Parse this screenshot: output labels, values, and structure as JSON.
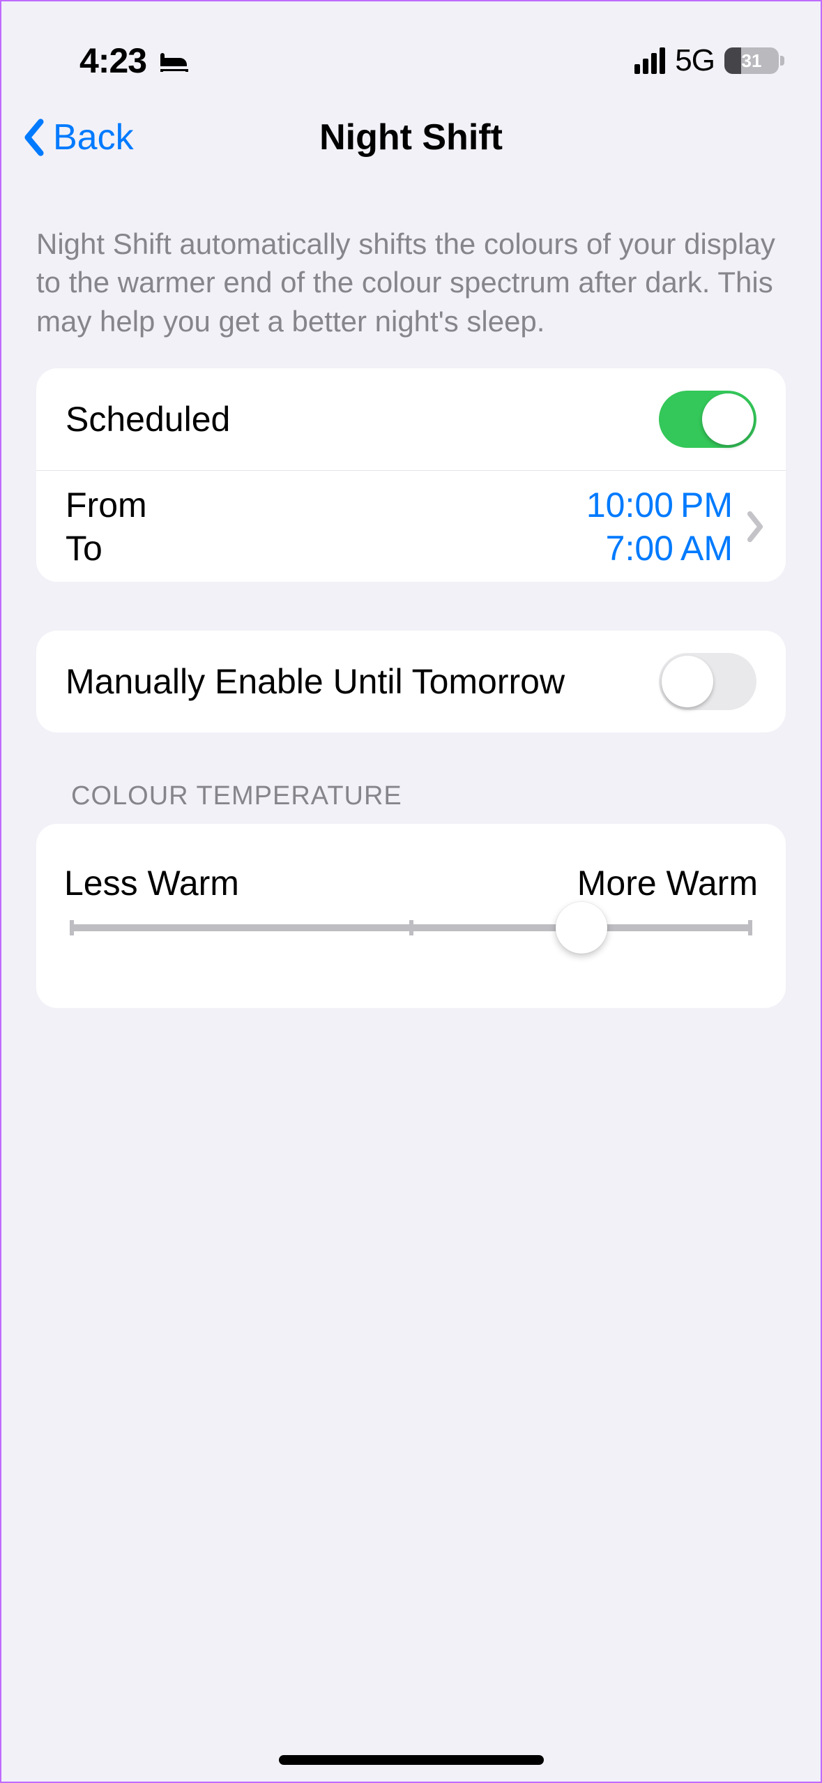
{
  "status": {
    "time": "4:23",
    "network": "5G",
    "battery_pct": "31"
  },
  "nav": {
    "back_label": "Back",
    "title": "Night Shift"
  },
  "intro": "Night Shift automatically shifts the colours of your display to the warmer end of the colour spectrum after dark. This may help you get a better night's sleep.",
  "scheduled": {
    "label": "Scheduled",
    "enabled": true,
    "from_label": "From",
    "to_label": "To",
    "from_value": "10:00 PM",
    "to_value": "7:00 AM"
  },
  "manual": {
    "label": "Manually Enable Until Tomorrow",
    "enabled": false
  },
  "temperature": {
    "header": "COLOUR TEMPERATURE",
    "less_label": "Less Warm",
    "more_label": "More Warm",
    "value_pct": 75
  }
}
